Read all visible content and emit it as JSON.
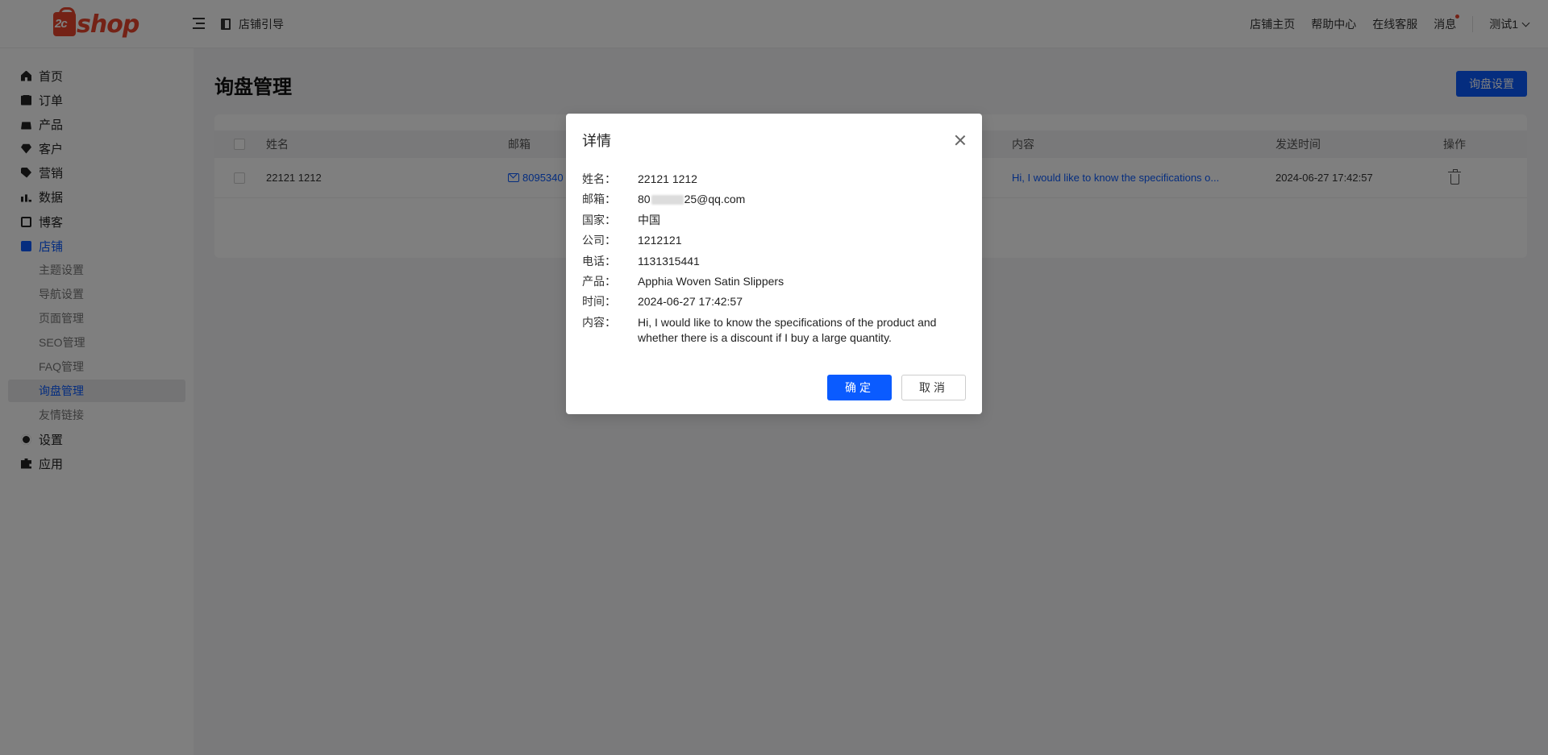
{
  "header": {
    "logo_text": "shop",
    "logo_badge": "2c",
    "guide_label": "店铺引导",
    "links": [
      "店铺主页",
      "帮助中心",
      "在线客服",
      "消息"
    ],
    "user_name": "测试1"
  },
  "sidebar": {
    "items": [
      {
        "label": "首页",
        "icon": "home-icon"
      },
      {
        "label": "订单",
        "icon": "order-icon"
      },
      {
        "label": "产品",
        "icon": "bag-icon"
      },
      {
        "label": "客户",
        "icon": "diamond-icon"
      },
      {
        "label": "营销",
        "icon": "tag-icon"
      },
      {
        "label": "数据",
        "icon": "bar-chart-icon"
      },
      {
        "label": "博客",
        "icon": "edit-icon"
      },
      {
        "label": "店铺",
        "icon": "store-icon"
      },
      {
        "label": "设置",
        "icon": "gear-icon"
      },
      {
        "label": "应用",
        "icon": "puzzle-icon"
      }
    ],
    "store_sub_items": [
      "主题设置",
      "导航设置",
      "页面管理",
      "SEO管理",
      "FAQ管理",
      "询盘管理",
      "友情链接"
    ],
    "active_item": "店铺",
    "active_sub_item": "询盘管理",
    "accent_color": "#0a5bff"
  },
  "main": {
    "title": "询盘管理",
    "settings_button": "询盘设置",
    "table": {
      "headers": {
        "name": "姓名",
        "email": "邮箱",
        "content": "内容",
        "time": "发送时间",
        "action": "操作"
      },
      "rows": [
        {
          "name": "22121 1212",
          "email": "8095340",
          "content": "Hi, I would like to know the specifications o...",
          "time": "2024-06-27 17:42:57"
        }
      ]
    }
  },
  "modal": {
    "title": "详情",
    "fields": [
      {
        "key": "姓名：",
        "value": "22121 1212"
      },
      {
        "key": "邮箱：",
        "value_prefix": "80",
        "value_suffix": "25@qq.com"
      },
      {
        "key": "国家：",
        "value": "中国"
      },
      {
        "key": "公司：",
        "value": "1212121"
      },
      {
        "key": "电话：",
        "value": "1131315441"
      },
      {
        "key": "产品：",
        "value": "Apphia Woven Satin Slippers"
      },
      {
        "key": "时间：",
        "value": "2024-06-27 17:42:57"
      },
      {
        "key": "内容：",
        "value": "Hi, I would like to know the specifications of the product and whether there is a discount if I buy a large quantity."
      }
    ],
    "ok_label": "确定",
    "cancel_label": "取消"
  }
}
